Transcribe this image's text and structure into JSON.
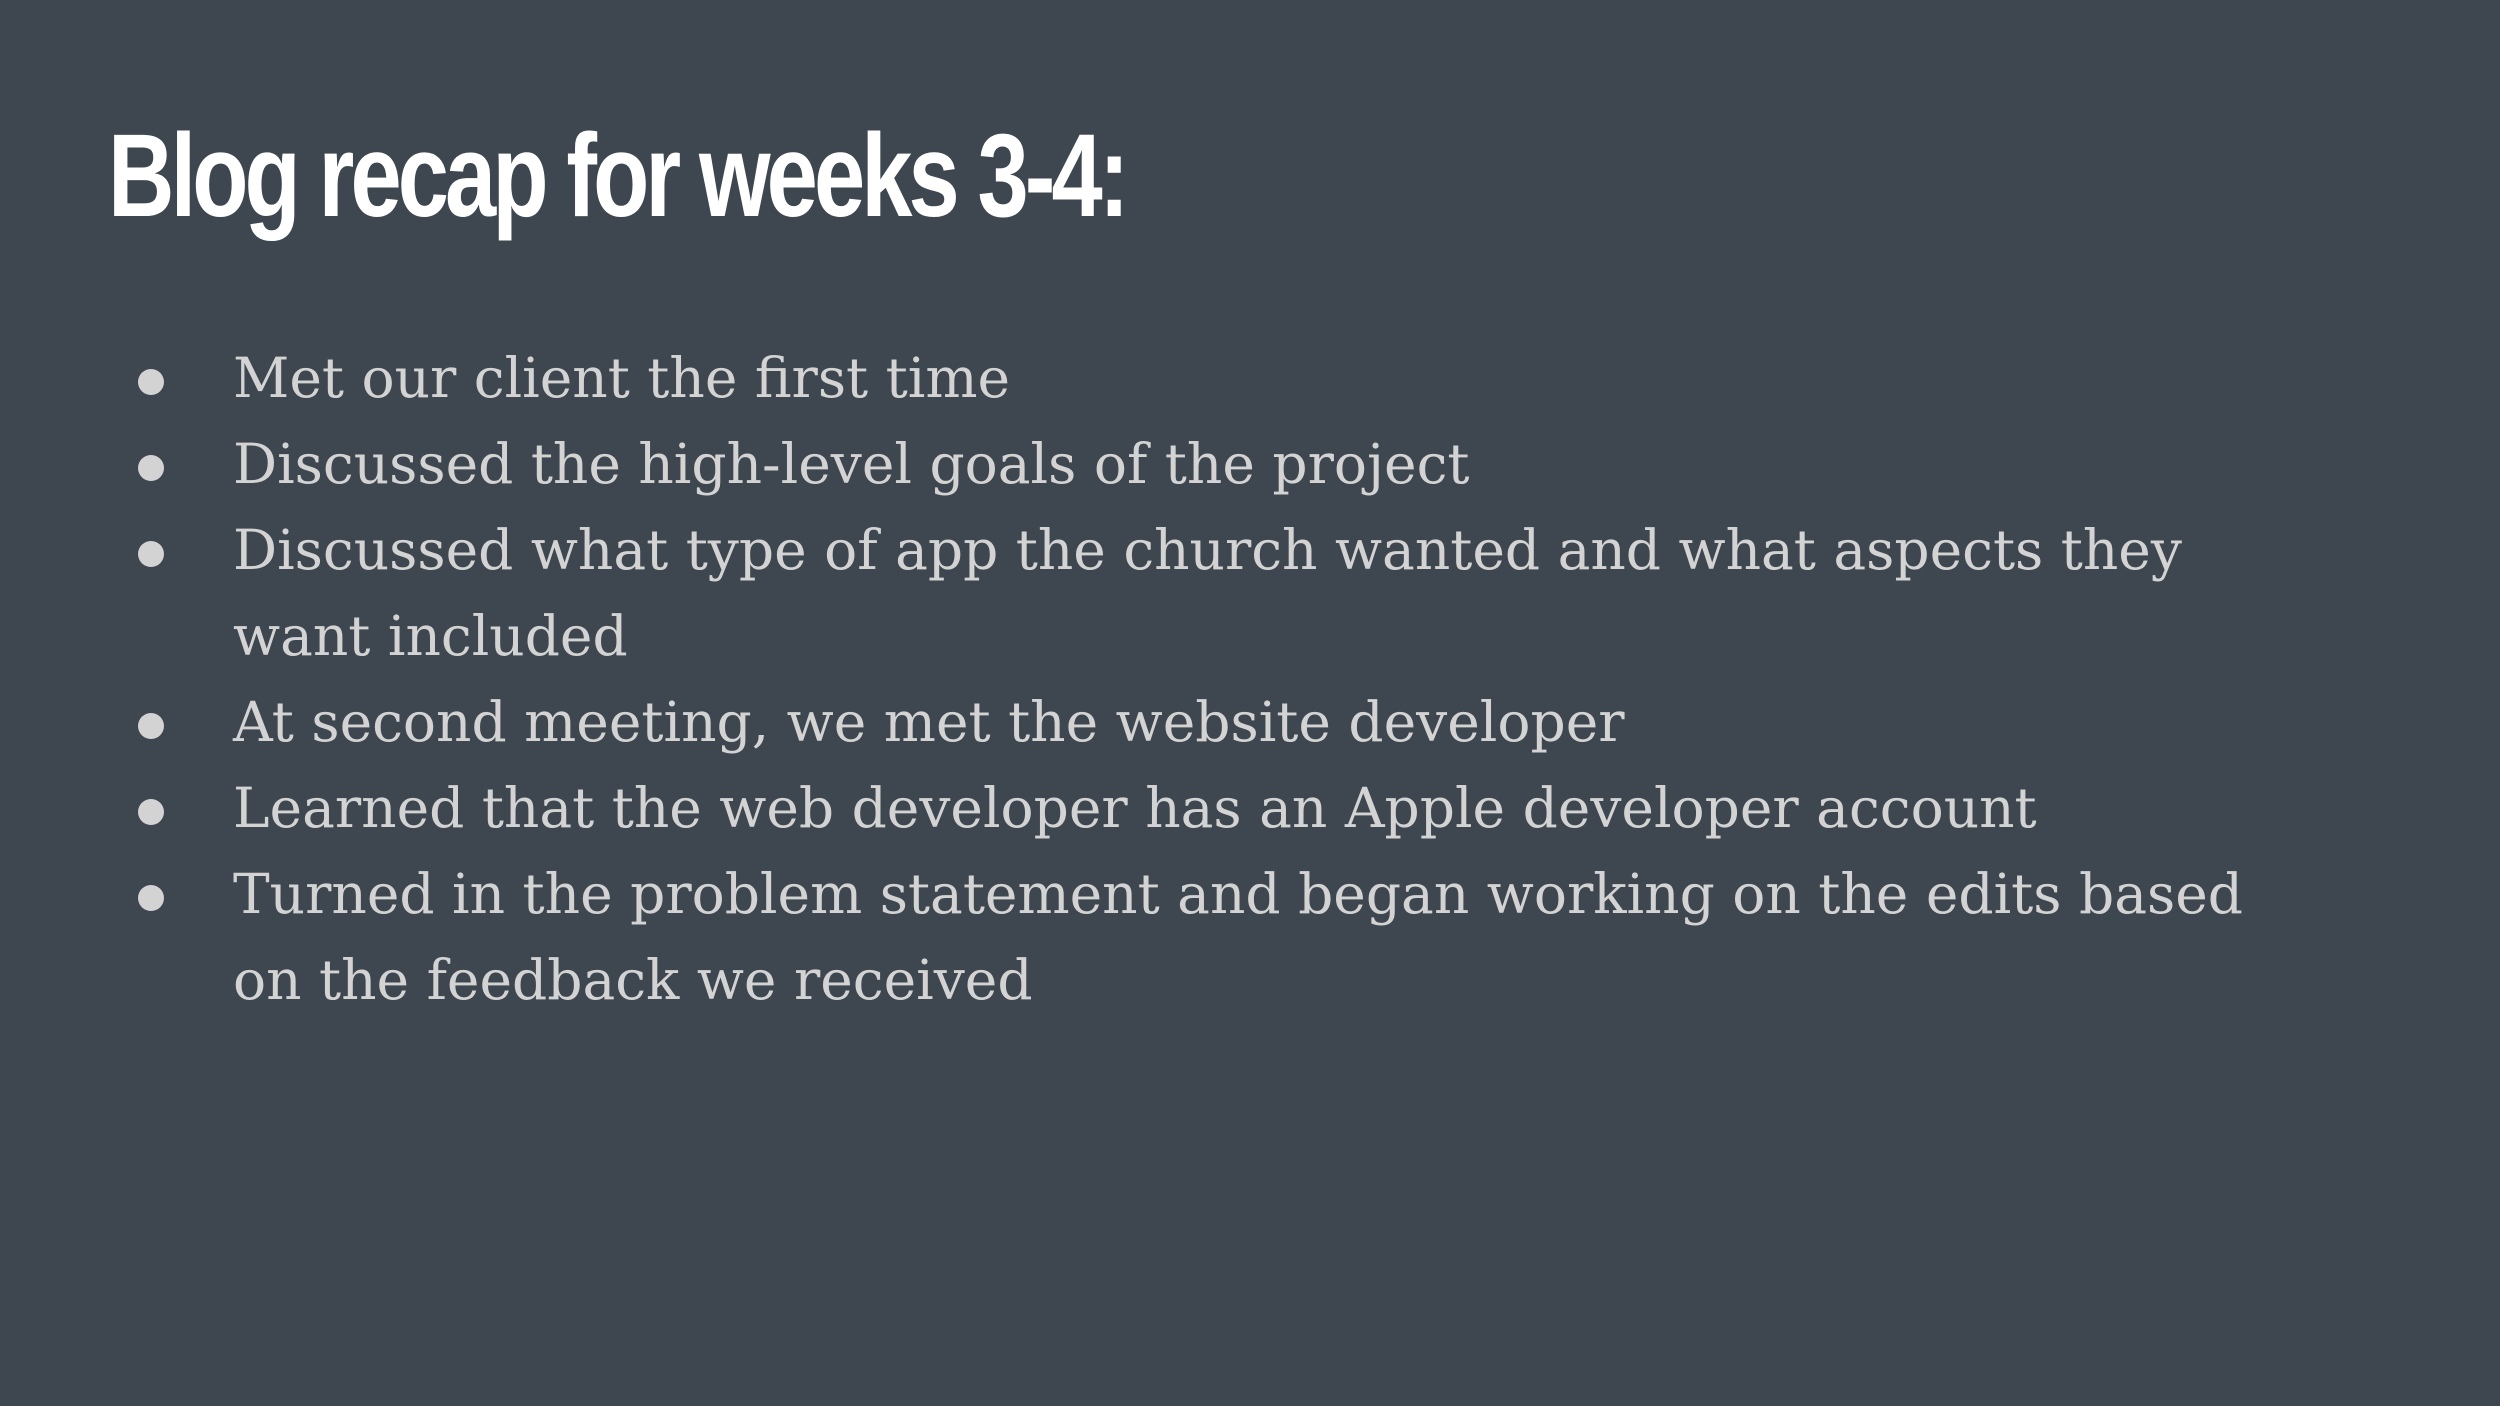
{
  "slide": {
    "title": "Blog recap for weeks 3-4:",
    "bullets": [
      "Met our client the first time",
      "Discussed the high-level goals of the project",
      "Discussed what type of app the church wanted and what aspects they want included",
      "At second meeting, we met the website developer",
      "Learned that the web developer has an Apple developer account",
      "Turned in the problem statement and began working on the edits based on the feedback we received"
    ]
  },
  "colors": {
    "background": "#3e474f",
    "title": "#ffffff",
    "body_text": "#d3d3d3"
  }
}
